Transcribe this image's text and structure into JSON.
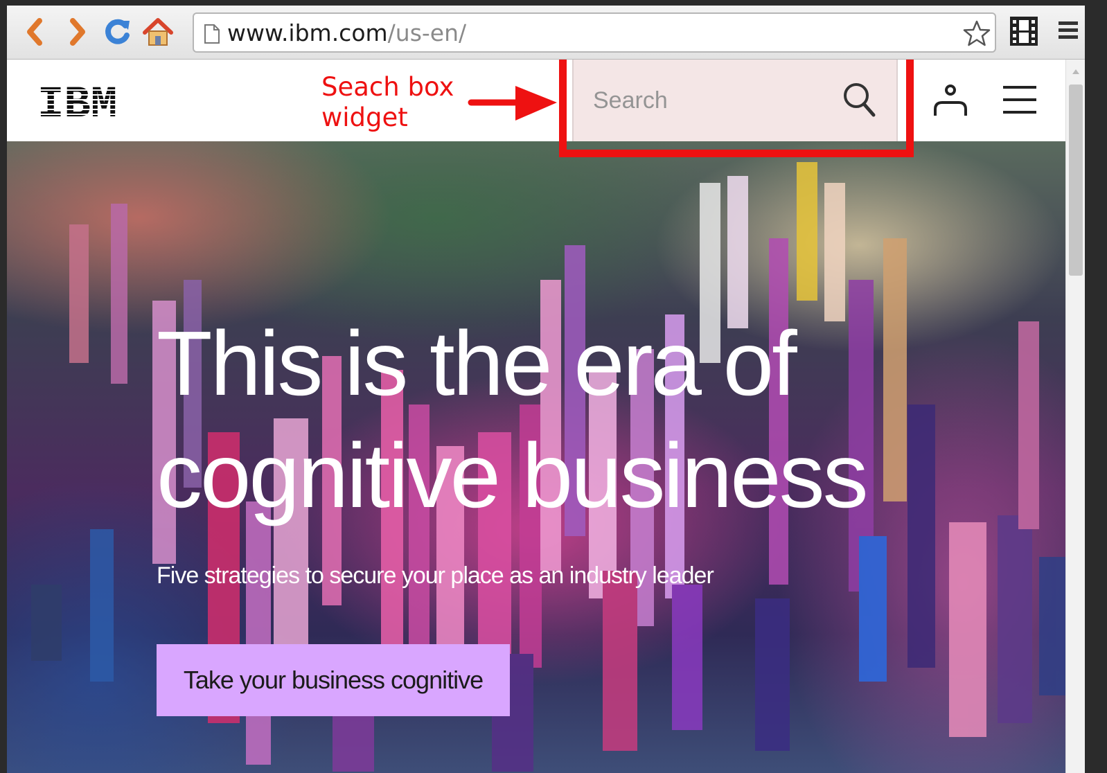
{
  "browser": {
    "url_host": "www.ibm.com",
    "url_path": "/us-en/"
  },
  "site": {
    "logo_text": "IBM",
    "search": {
      "placeholder": "Search"
    }
  },
  "annotation": {
    "label": "Seach box widget",
    "color": "#ee1111"
  },
  "hero": {
    "headline": "This is the era of cognitive business",
    "subheadline": "Five strategies to secure your place as an industry leader",
    "cta_label": "Take your business cognitive",
    "cta_color": "#d9a6ff"
  },
  "icons": {
    "back": "chevron-left-icon",
    "forward": "chevron-right-icon",
    "reload": "reload-icon",
    "home": "home-icon",
    "page": "page-icon",
    "bookmark": "star-icon",
    "extension": "film-icon",
    "browser_menu": "menu-icon",
    "search": "search-icon",
    "account": "account-icon",
    "site_menu": "hamburger-icon"
  }
}
